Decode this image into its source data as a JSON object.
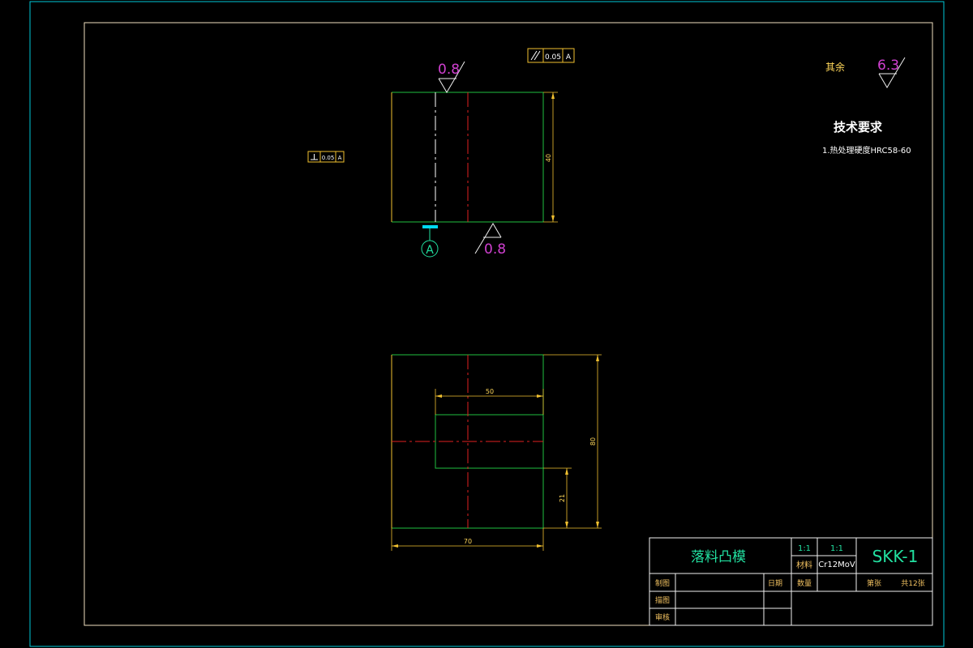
{
  "drawing": {
    "part_name": "落料凸模",
    "scale_1": "1:1",
    "scale_2": "1:1",
    "material_label": "材料",
    "material": "Cr12MoV",
    "drawing_no": "SKK-1",
    "title_block": {
      "drawn_label": "制图",
      "date_label": "日期",
      "qty_label": "数量",
      "sheet_label": "第张",
      "total_label": "共12张",
      "drawn_by_label": "描图",
      "checked_label": "审核"
    }
  },
  "tech": {
    "title": "技术要求",
    "item1": "1.热处理硬度HRC58-60",
    "other_label": "其余",
    "other_roughness": "6.3"
  },
  "annotations": {
    "roughness_top": "0.8",
    "roughness_bottom": "0.8",
    "parallel_tol": "0.05",
    "parallel_datum": "A",
    "perp_tol": "0.05",
    "perp_datum": "A",
    "datum_label": "A"
  },
  "dimensions": {
    "front_height": "40",
    "top_width_inner": "50",
    "top_height": "80",
    "top_offset": "21",
    "top_width": "70"
  },
  "colors": {
    "frame_outer": "#00c8d8",
    "frame_inner": "#f0c070",
    "outline": "#20c040",
    "dim": "#f0c030",
    "center": "#e02020",
    "magenta": "#d040d0",
    "datum_cyan": "#00d8f0"
  }
}
